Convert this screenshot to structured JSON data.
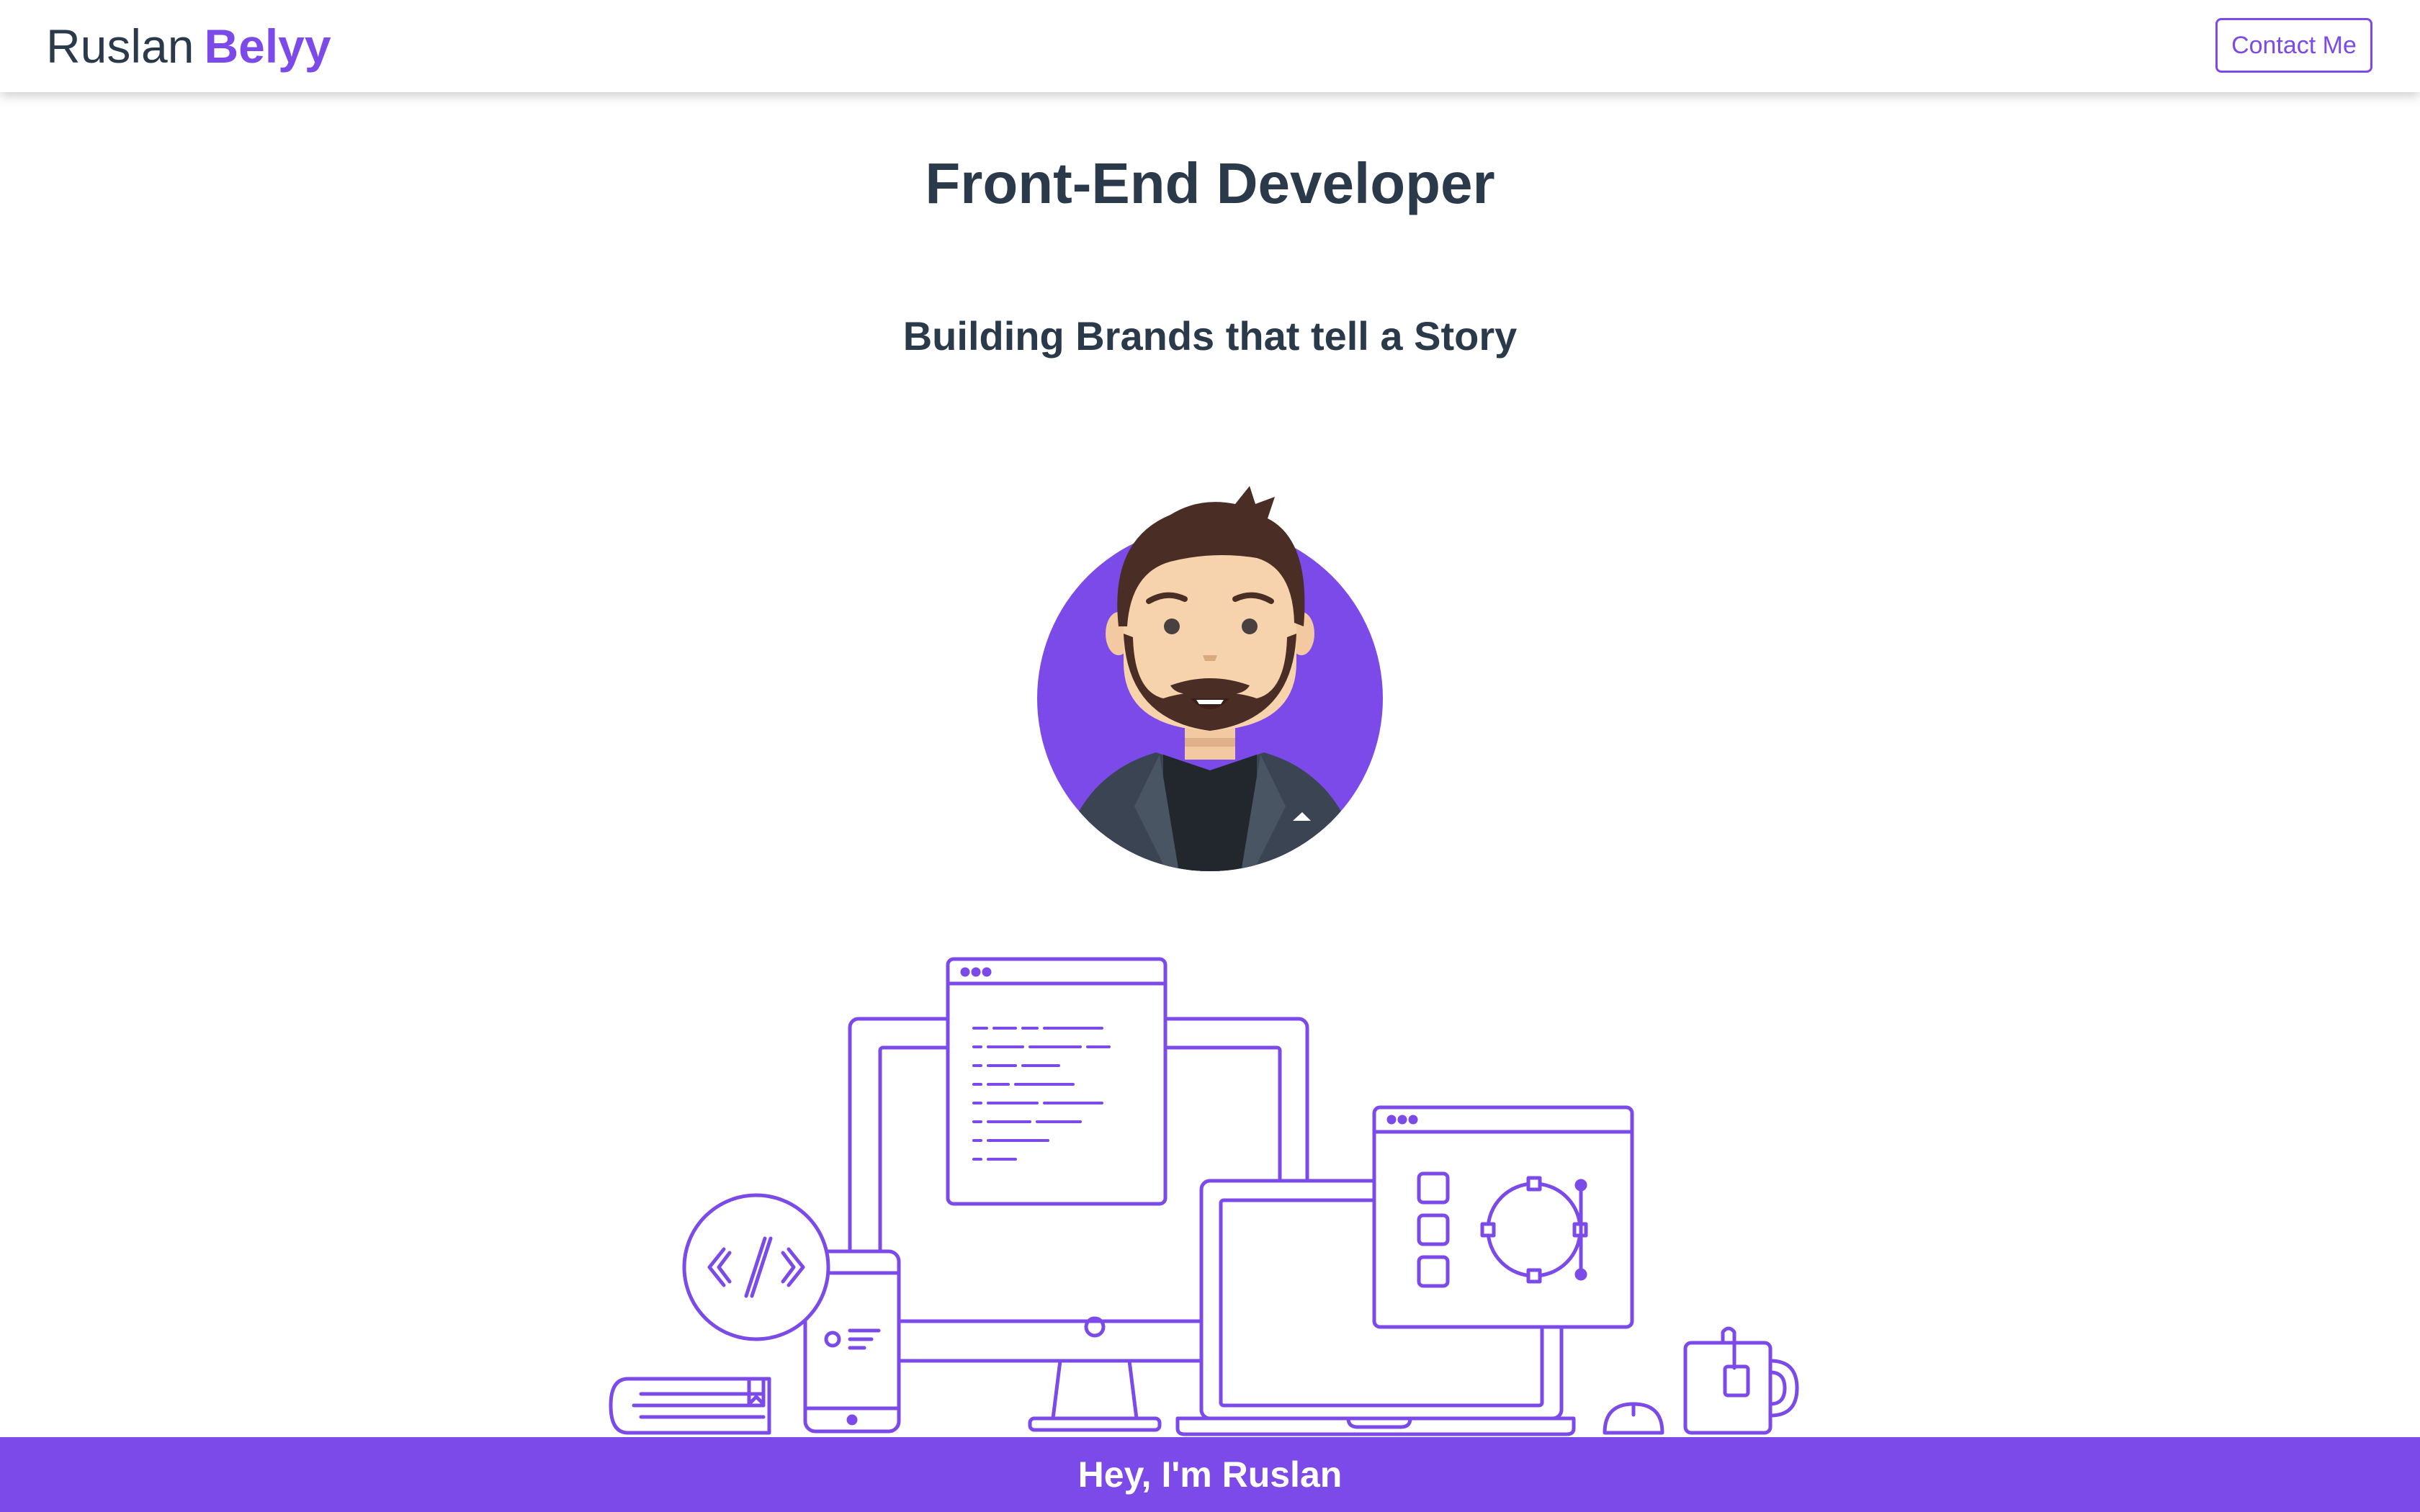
{
  "header": {
    "first_name": "Ruslan",
    "last_name": "Belyy",
    "contact_label": "Contact Me"
  },
  "hero": {
    "title": "Front-End Developer",
    "tagline": "Building Brands that tell a Story"
  },
  "banner": {
    "greeting": "Hey, I'm Ruslan"
  },
  "colors": {
    "accent": "#7b4ae8",
    "text": "#2b3a4a",
    "background": "#ffffff"
  },
  "icons": [
    "avatar-illustration",
    "devices-illustration",
    "code-icon",
    "bezier-icon",
    "mug-icon",
    "book-icon",
    "mouse-icon"
  ]
}
